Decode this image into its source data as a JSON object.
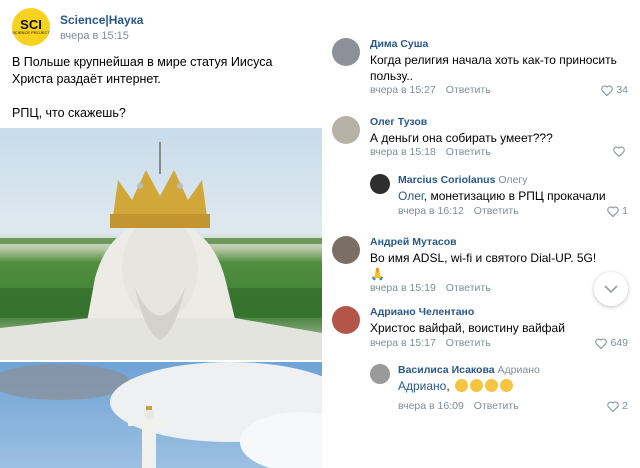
{
  "post": {
    "author": "Science|Наука",
    "logo_text": "SCI",
    "logo_subtext": "SCIENCE PROJECT",
    "time": "вчера в 15:15",
    "text": "В Польше крупнейшая в мире статуя Иисуса Христа раздаёт интернет.\n\nРПЦ, что скажешь?"
  },
  "comments": [
    {
      "name": "Дима Суша",
      "text": "Когда религия начала хоть как-то приносить пользу..",
      "time": "вчера в 15:27",
      "reply": "Ответить",
      "likes": "34"
    },
    {
      "name": "Олег Тузов",
      "text": "А деньги она собирать умеет???",
      "time": "вчера в 15:18",
      "reply": "Ответить",
      "likes": ""
    },
    {
      "name": "Marcius Coriolanus",
      "reply_to": "Олегу",
      "mention": "Олег",
      "text": ", монетизацию в РПЦ прокачали",
      "time": "вчера в 16:12",
      "reply": "Ответить",
      "likes": "1"
    },
    {
      "name": "Андрей Мутасов",
      "text": "Во имя ADSL, wi-fi и святого Dial-UP. 5G! 🙏",
      "time": "вчера в 15:19",
      "reply": "Ответить",
      "likes": ""
    },
    {
      "name": "Адриано Челентано",
      "text": "Христос вайфай, воистину вайфай",
      "time": "вчера в 15:17",
      "reply": "Ответить",
      "likes": "649"
    },
    {
      "name": "Василиса Исакова",
      "reply_to": "Адриано",
      "mention": "Адриано",
      "text": ",",
      "time": "вчера в 16:09",
      "reply": "Ответить",
      "likes": "2"
    }
  ],
  "colors": {
    "link": "#2a5885",
    "meta": "#818c99",
    "logo": "#f7d21e"
  }
}
